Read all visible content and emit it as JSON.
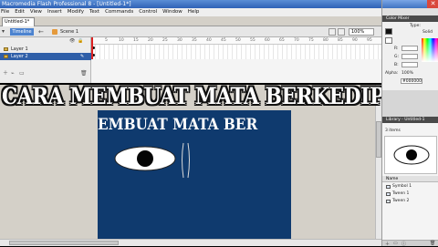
{
  "window": {
    "title": "Macromedia Flash Professional 8 - [Untitled-1*]"
  },
  "menu": [
    "File",
    "Edit",
    "View",
    "Insert",
    "Modify",
    "Text",
    "Commands",
    "Control",
    "Window",
    "Help"
  ],
  "document_tab": "Untitled-1*",
  "timeline_header": {
    "timeline_button": "Timeline",
    "scene": "Scene 1",
    "zoom": "100%"
  },
  "layers": [
    {
      "name": "Layer 1",
      "selected": false
    },
    {
      "name": "Layer 2",
      "selected": true
    }
  ],
  "ruler_marks": [
    "5",
    "10",
    "15",
    "20",
    "25",
    "30",
    "35",
    "40",
    "45",
    "50",
    "55",
    "60",
    "65",
    "70",
    "75",
    "80",
    "85",
    "90",
    "95"
  ],
  "timeline_status": {
    "frame": "1",
    "fps": "12.0 fps",
    "time": "0.0s"
  },
  "overlay_title": "CARA MEMBUAT MATA BERKEDIP",
  "stage_text": "EMBUAT MATA BER",
  "right_panel": {
    "color_mixer": {
      "title": "Color Mixer",
      "type_label": "Type:",
      "type_value": "Solid",
      "r_label": "R:",
      "g_label": "G:",
      "b_label": "B:",
      "alpha_label": "Alpha:",
      "alpha_value": "100%",
      "hex": "#000000"
    },
    "library": {
      "title": "Library - Untitled-1",
      "item_count": "3 items",
      "column_name": "Name"
    },
    "library_items": [
      "Symbol 1",
      "Tween 1",
      "Tween 2"
    ]
  },
  "colors": {
    "stage": "#0f3a6e",
    "title_bar": "#2f62b6",
    "selected_layer": "#2f5fa8"
  }
}
